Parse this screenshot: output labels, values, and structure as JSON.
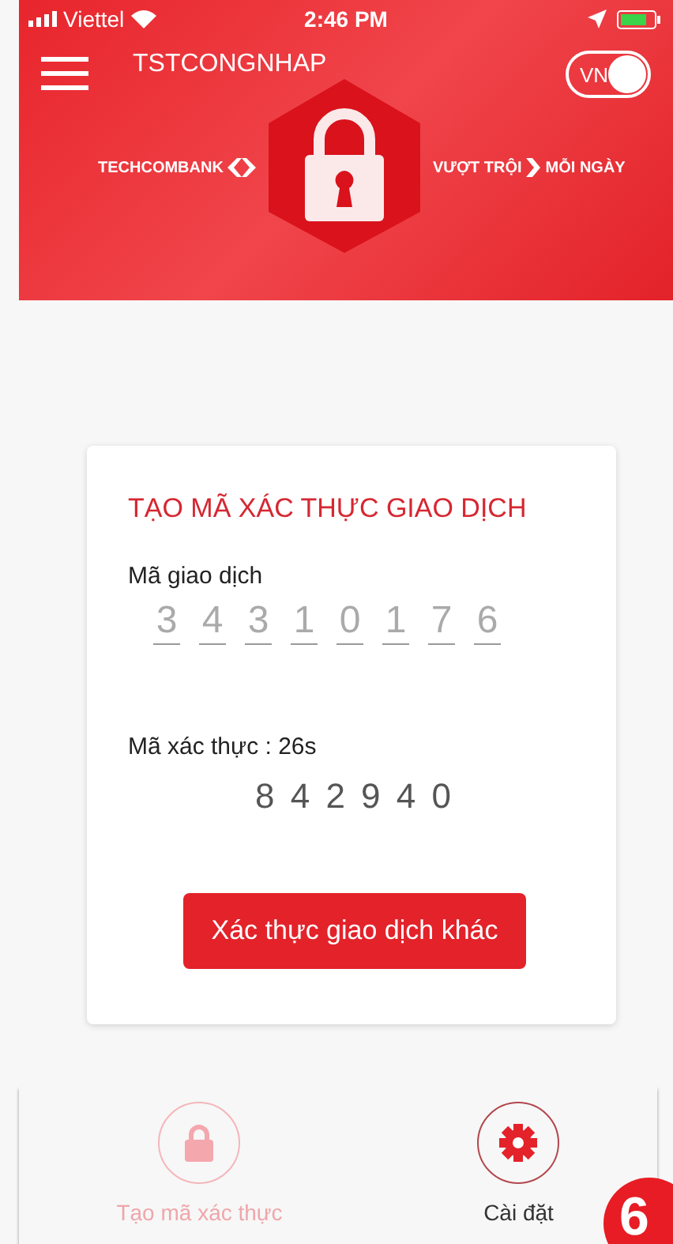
{
  "status_bar": {
    "carrier": "Viettel",
    "time": "2:46 PM"
  },
  "header": {
    "title": "TSTCONGNHAP",
    "language": {
      "label": "VN",
      "on": true
    },
    "brand_left": "TECHCOMBANK",
    "brand_right_1": "VƯỢT TRỘI",
    "brand_right_2": "MỖI NGÀY"
  },
  "card": {
    "title": "TẠO MÃ XÁC THỰC GIAO DỊCH",
    "transaction_label": "Mã giao dịch",
    "transaction_digits": [
      "3",
      "4",
      "3",
      "1",
      "0",
      "1",
      "7",
      "6"
    ],
    "auth_label": "Mã xác thực : 26s",
    "auth_code": "8 4 2 9 4 0",
    "button": "Xác thực giao dịch khác"
  },
  "bottom_nav": [
    {
      "label": "Tạo mã xác thực",
      "kind": "lock",
      "disabled": true
    },
    {
      "label": "Cài đặt",
      "kind": "gear",
      "disabled": false
    }
  ],
  "step_badge": "6"
}
